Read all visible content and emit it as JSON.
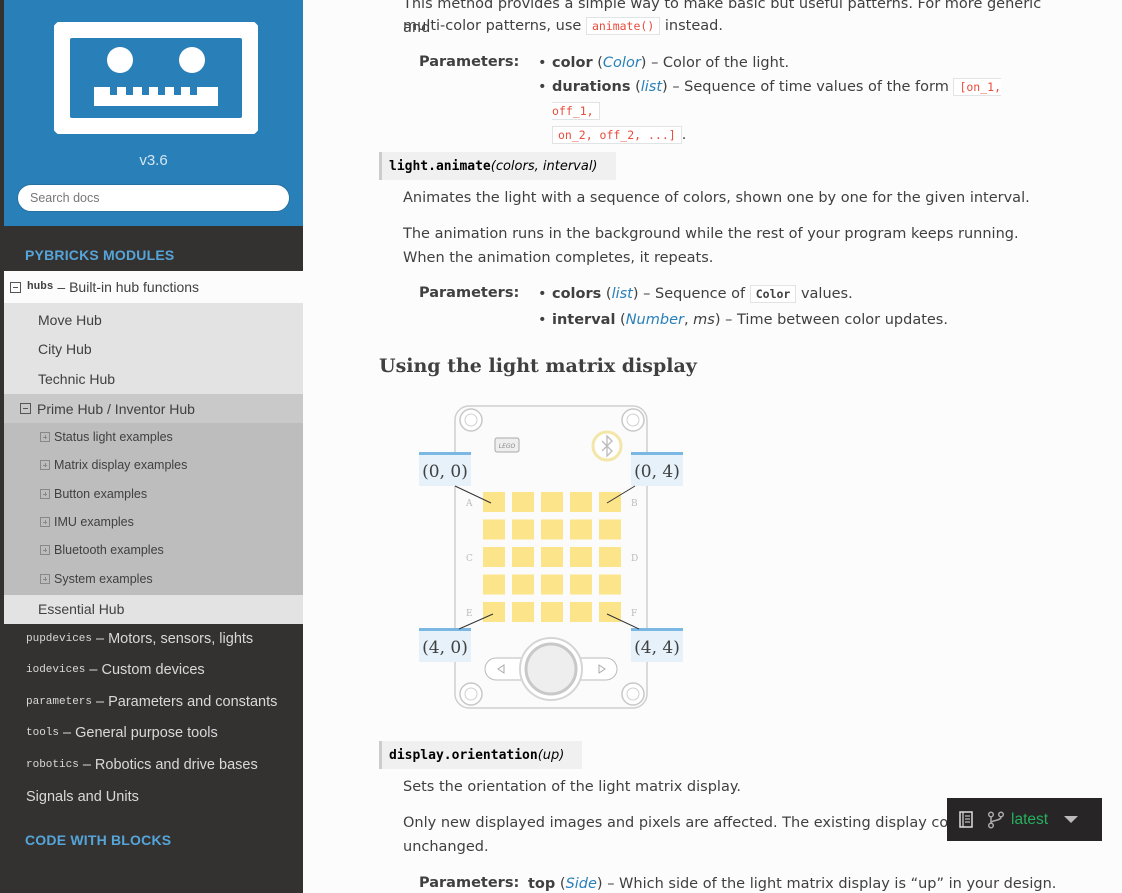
{
  "sidebar": {
    "version": "v3.6",
    "search_placeholder": "Search docs",
    "caption_modules": "PYBRICKS MODULES",
    "caption_blocks": "CODE WITH BLOCKS",
    "active_module": {
      "code": "hubs",
      "label": "– Built-in hub functions"
    },
    "hubs": [
      "Move Hub",
      "City Hub",
      "Technic Hub"
    ],
    "prime_hub": "Prime Hub / Inventor Hub",
    "prime_examples": [
      "Status light examples",
      "Matrix display examples",
      "Button examples",
      "IMU examples",
      "Bluetooth examples",
      "System examples"
    ],
    "essential_hub": "Essential Hub",
    "modules": [
      {
        "code": "pupdevices",
        "label": "– Motors, sensors, lights"
      },
      {
        "code": "iodevices",
        "label": "– Custom devices"
      },
      {
        "code": "parameters",
        "label": "– Parameters and constants"
      },
      {
        "code": "tools",
        "label": "– General purpose tools"
      },
      {
        "code": "robotics",
        "label": "– Robotics and drive bases"
      }
    ],
    "signals": "Signals and Units"
  },
  "content": {
    "intro_1": "This method provides a simple way to make basic but useful patterns. For more generic and",
    "intro_2a": "multi-color patterns, use",
    "intro_code": "animate()",
    "intro_2b": "instead.",
    "params_label": "Parameters:",
    "blink_params": {
      "color_name": "color",
      "color_type": "Color",
      "color_desc": "– Color of the light.",
      "dur_name": "durations",
      "dur_type": "list",
      "dur_desc": "– Sequence of time values of the form",
      "dur_code_1": "[on_1, off_1,",
      "dur_code_2": "on_2, off_2, ...]",
      "dur_end": "."
    },
    "animate_sig": {
      "fn": "light.animate",
      "args": "(colors, interval)"
    },
    "animate_desc_1": "Animates the light with a sequence of colors, shown one by one for the given interval.",
    "animate_desc_2": "The animation runs in the background while the rest of your program keeps running. When the animation completes, it repeats.",
    "animate_params": {
      "colors_name": "colors",
      "colors_type": "list",
      "colors_desc_a": "– Sequence of",
      "colors_code": "Color",
      "colors_desc_b": "values.",
      "interval_name": "interval",
      "interval_type_1": "Number",
      "interval_type_2": "ms",
      "interval_desc": "– Time between color updates."
    },
    "heading_display": "Using the light matrix display",
    "figure": {
      "label_tl": "(0, 0)",
      "label_tr": "(0, 4)",
      "label_bl": "(4, 0)",
      "label_br": "(4, 4)",
      "port_a": "A",
      "port_b": "B",
      "port_c": "C",
      "port_d": "D",
      "port_e": "E",
      "port_f": "F",
      "pixel_color": "#fce48a",
      "accent_color": "#7ab7e3"
    },
    "orientation_sig": {
      "fn": "display.orientation",
      "args": "(up)"
    },
    "orientation_desc_1": "Sets the orientation of the light matrix display.",
    "orientation_desc_2a": "Only new displayed images and pixels are affected. The existing display conter",
    "orientation_desc_2b": "unchanged.",
    "orientation_param": {
      "name": "top",
      "type": "Side",
      "desc": "– Which side of the light matrix display is “up” in your design."
    }
  },
  "flyout": {
    "version": "latest",
    "icon_book": "book-icon",
    "icon_branch": "git-branch-icon"
  },
  "colors": {
    "sidebar_top": "#2980b9",
    "sidebar_bg": "#343131",
    "caption": "#55a5d9",
    "link": "#2980b9",
    "code_red": "#e74c3c",
    "flyout_green": "#27ae60"
  }
}
